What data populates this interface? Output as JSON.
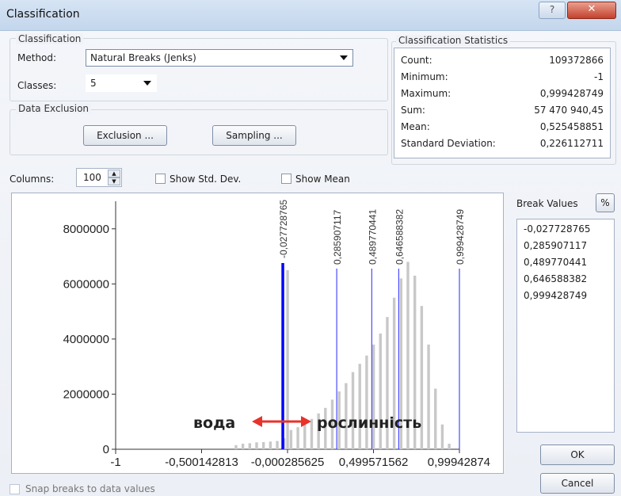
{
  "window": {
    "title": "Classification"
  },
  "classification": {
    "group_label": "Classification",
    "method_label": "Method:",
    "method_value": "Natural Breaks (Jenks)",
    "classes_label": "Classes:",
    "classes_value": "5"
  },
  "exclusion": {
    "group_label": "Data Exclusion",
    "exclusion_button": "Exclusion ...",
    "sampling_button": "Sampling ..."
  },
  "stats": {
    "group_label": "Classification Statistics",
    "rows": [
      {
        "label": "Count:",
        "value": "109372866"
      },
      {
        "label": "Minimum:",
        "value": "-1"
      },
      {
        "label": "Maximum:",
        "value": "0,999428749"
      },
      {
        "label": "Sum:",
        "value": "57 470 940,45"
      },
      {
        "label": "Mean:",
        "value": "0,525458851"
      },
      {
        "label": "Standard Deviation:",
        "value": "0,226112711"
      }
    ]
  },
  "columns": {
    "label": "Columns:",
    "value": "100"
  },
  "checkboxes": {
    "std_dev": "Show Std. Dev.",
    "mean": "Show Mean",
    "snap": "Snap breaks to data values"
  },
  "break_values": {
    "label": "Break Values",
    "percent_button": "%",
    "values": [
      "-0,027728765",
      "0,285907117",
      "0,489770441",
      "0,646588382",
      "0,999428749"
    ]
  },
  "annotations": {
    "left": "вода",
    "right": "рослинність"
  },
  "buttons": {
    "ok": "OK",
    "cancel": "Cancel"
  },
  "colors": {
    "bars": "#c8c8c8",
    "selected_break": "#0000ff",
    "break": "#4a4aff",
    "arrow": "#e8322a"
  },
  "chart_data": {
    "type": "bar",
    "x_range": [
      -1,
      0.999428749
    ],
    "ylim": [
      0,
      9000000
    ],
    "y_ticks": [
      "0",
      "2000000",
      "4000000",
      "6000000",
      "8000000"
    ],
    "y_tick_values": [
      0,
      2000000,
      4000000,
      6000000,
      8000000
    ],
    "x_ticks": [
      "-1",
      "-0,500142813",
      "-0,000285625",
      "0,499571562",
      "0,99942874"
    ],
    "x_tick_values": [
      -1,
      -0.500142813,
      -0.000285625,
      0.499571562,
      0.99942874
    ],
    "break_labels": [
      "-0,027728765",
      "0,285907117",
      "0,489770441",
      "0,646588382",
      "0,999428749"
    ],
    "breaks": [
      -0.027728765,
      0.285907117,
      0.489770441,
      0.646588382,
      0.999428749
    ],
    "selected_break": 0,
    "bins_x": [
      -0.3,
      -0.26,
      -0.22,
      -0.18,
      -0.14,
      -0.1,
      -0.06,
      -0.02,
      0.0,
      0.02,
      0.06,
      0.1,
      0.14,
      0.18,
      0.22,
      0.26,
      0.3,
      0.34,
      0.38,
      0.42,
      0.46,
      0.5,
      0.54,
      0.58,
      0.62,
      0.66,
      0.7,
      0.74,
      0.78,
      0.82,
      0.86,
      0.9,
      0.94
    ],
    "bins_y": [
      150000,
      200000,
      220000,
      250000,
      260000,
      280000,
      300000,
      400000,
      6500000,
      700000,
      800000,
      900000,
      1100000,
      1300000,
      1500000,
      1800000,
      2100000,
      2400000,
      2800000,
      3100000,
      3400000,
      3800000,
      4200000,
      4800000,
      5500000,
      6200000,
      6800000,
      6300000,
      5200000,
      3800000,
      2200000,
      900000,
      200000
    ]
  }
}
